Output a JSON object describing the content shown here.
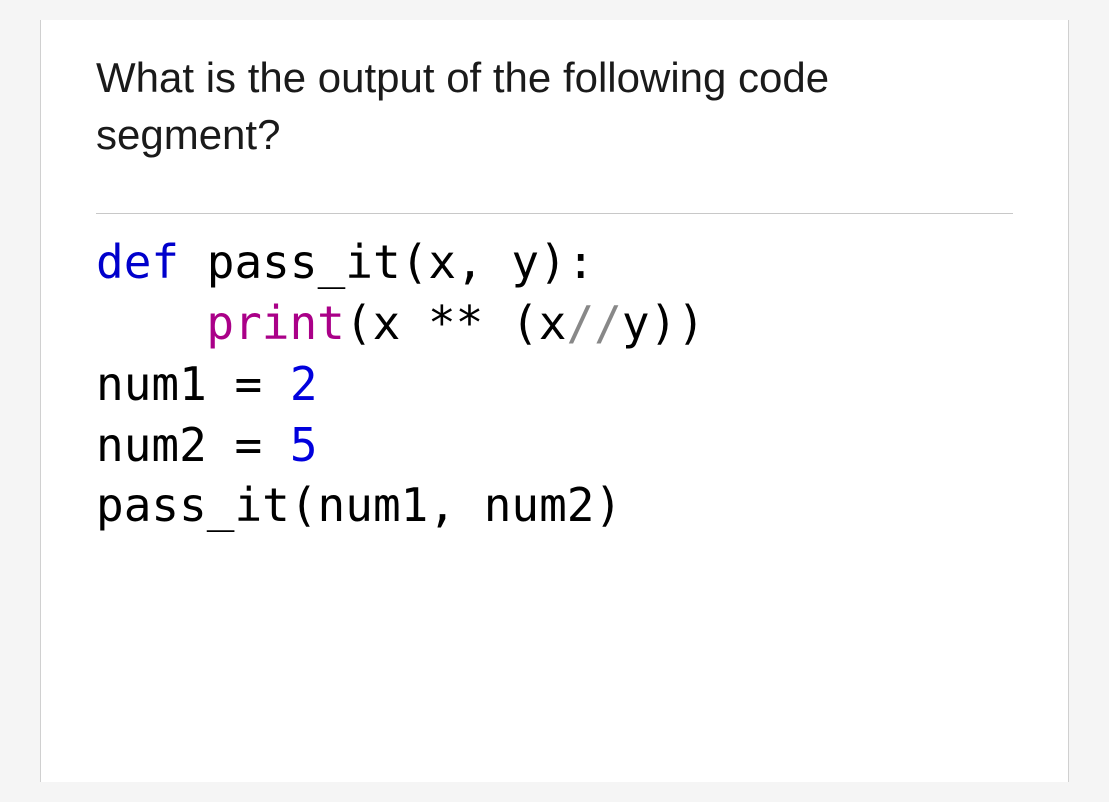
{
  "question": {
    "prompt": "What is the output of the following code segment?"
  },
  "code": {
    "line1": {
      "kw": "def",
      "rest": " pass_it(x, y):"
    },
    "line2": {
      "fn": "print",
      "part1": "(x ** (x",
      "slashes": "//",
      "part2": "y))"
    },
    "line3": {
      "var": "num1 = ",
      "val": "2"
    },
    "line4": {
      "var": "num2 = ",
      "val": "5"
    },
    "line5": {
      "text": "pass_it(num1, num2)"
    }
  }
}
